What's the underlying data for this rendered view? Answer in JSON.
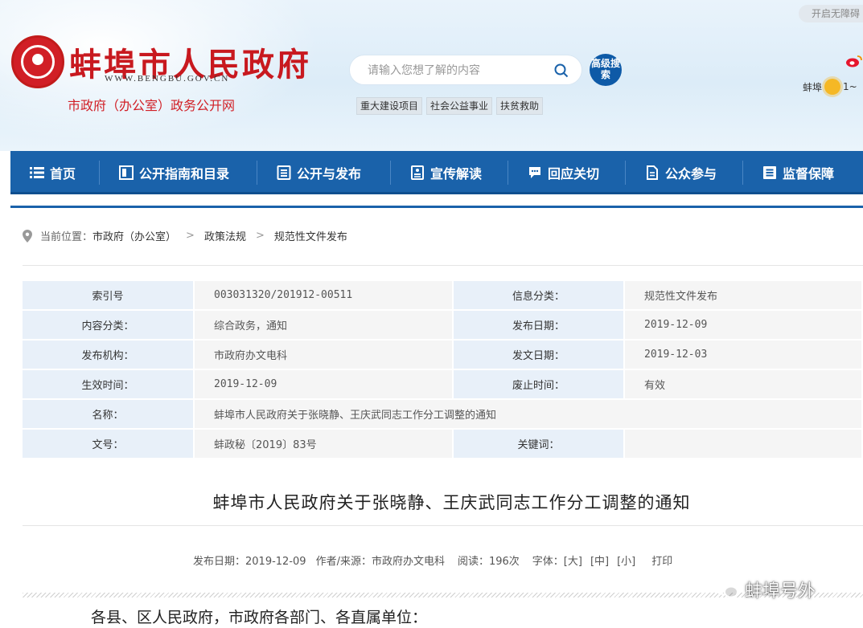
{
  "header": {
    "site_title": "蚌埠市人民政府",
    "site_url": "WWW.BENGBU.GOV.CN",
    "subsite": "市政府（办公室）政务公开网",
    "search_placeholder": "请输入您想了解的内容",
    "advanced_search": "高级搜索",
    "hot_links": [
      "重大建设项目",
      "社会公益事业",
      "扶贫救助"
    ],
    "accessibility": "开启无障碍",
    "weather_city": "蚌埠",
    "weather_temp": "1~"
  },
  "nav": [
    {
      "label": "首页",
      "icon": "list-icon"
    },
    {
      "label": "公开指南和目录",
      "icon": "book-icon"
    },
    {
      "label": "公开与发布",
      "icon": "document-list-icon"
    },
    {
      "label": "宣传解读",
      "icon": "document-icon"
    },
    {
      "label": "回应关切",
      "icon": "chat-icon"
    },
    {
      "label": "公众参与",
      "icon": "edit-document-icon"
    },
    {
      "label": "监督保障",
      "icon": "menu-icon"
    }
  ],
  "breadcrumb": {
    "prefix": "当前位置：",
    "items": [
      "市政府（办公室）",
      "政策法规",
      "规范性文件发布"
    ],
    "separator": ">"
  },
  "info_table": {
    "index_label": "索引号",
    "index_value": "003031320/201912-00511",
    "category_label": "信息分类：",
    "category_value": "规范性文件发布",
    "content_class_label": "内容分类：",
    "content_class_value": "综合政务，通知",
    "publish_date_label": "发布日期：",
    "publish_date_value": "2019-12-09",
    "issuer_label": "发布机构：",
    "issuer_value": "市政府办文电科",
    "doc_date_label": "发文日期：",
    "doc_date_value": "2019-12-03",
    "effective_label": "生效时间：",
    "effective_value": "2019-12-09",
    "expire_label": "废止时间：",
    "expire_value": "有效",
    "name_label": "名称：",
    "name_value": "蚌埠市人民政府关于张晓静、王庆武同志工作分工调整的通知",
    "doc_no_label": "文号：",
    "doc_no_value": "蚌政秘〔2019〕83号",
    "keywords_label": "关键词：",
    "keywords_value": ""
  },
  "article": {
    "title": "蚌埠市人民政府关于张晓静、王庆武同志工作分工调整的通知",
    "meta_date": "发布日期：2019-12-09",
    "meta_author": "作者/来源：市政府办文电科",
    "meta_reads": "阅读：196次",
    "font_size_label": "字体：",
    "font_large": "[大]",
    "font_medium": "[中]",
    "font_small": "[小]",
    "print": "打印",
    "body_first_line": "各县、区人民政府，市政府各部门、各直属单位："
  },
  "watermark": "蚌埠号外",
  "colors": {
    "nav_blue": "#1a62aa",
    "brand_red": "#c8191f",
    "label_bg": "#e8f0f9",
    "value_bg": "#f5f5f5"
  }
}
